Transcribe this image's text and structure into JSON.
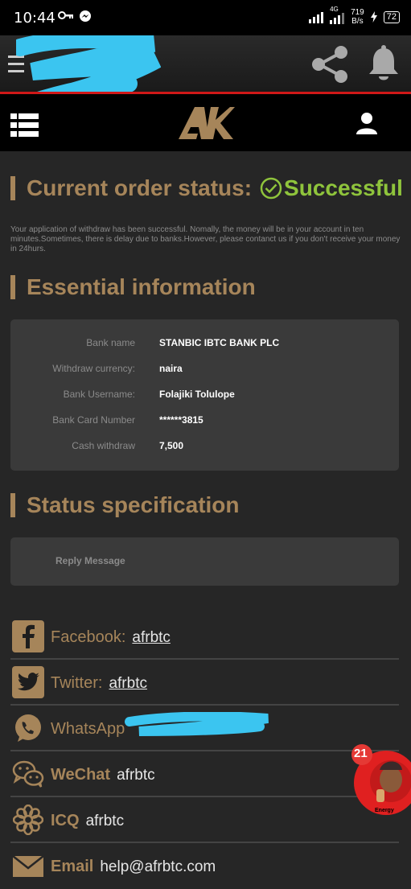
{
  "statusbar": {
    "time": "10:44",
    "network": "4G",
    "speed_value": "719",
    "speed_unit": "B/s",
    "battery": "72"
  },
  "appbar": {
    "menu_icon": "menu-icon",
    "share_icon": "share-icon",
    "bell_icon": "bell-icon"
  },
  "logobar": {
    "logo_text": "AK",
    "list_icon": "list-icon",
    "user_icon": "user-icon"
  },
  "order": {
    "heading": "Current order status:",
    "status": "Successful",
    "note": "Your application of withdraw has been successful. Nomally, the money will be in your account in ten minutes.Sometimes, there is delay due to banks.However, please contanct us if you don't receive your money in 24hurs."
  },
  "essential": {
    "heading": "Essential information",
    "rows": [
      {
        "label": "Bank name",
        "value": "STANBIC IBTC BANK PLC"
      },
      {
        "label": "Withdraw currency:",
        "value": "naira"
      },
      {
        "label": "Bank Username:",
        "value": "Folajiki Tolulope"
      },
      {
        "label": "Bank Card Number",
        "value": "******3815"
      },
      {
        "label": "Cash withdraw",
        "value": "7,500"
      }
    ]
  },
  "status_spec": {
    "heading": "Status specification",
    "reply_label": "Reply Message"
  },
  "social": [
    {
      "name": "Facebook:",
      "handle": "afrbtc",
      "icon": "facebook-icon"
    },
    {
      "name": "Twitter:",
      "handle": "afrbtc",
      "icon": "twitter-icon"
    },
    {
      "name": "WhatsApp",
      "handle": "",
      "icon": "whatsapp-icon"
    },
    {
      "name": "WeChat",
      "handle": "afrbtc",
      "icon": "wechat-icon"
    },
    {
      "name": "ICQ",
      "handle": "afrbtc",
      "icon": "icq-icon"
    },
    {
      "name": "Email",
      "handle": "help@afrbtc.com",
      "icon": "email-icon"
    }
  ],
  "chat_bubble": {
    "count": "21",
    "caption": "Energy"
  },
  "colors": {
    "accent_gold": "#a6855a",
    "success_green": "#8fc43c",
    "red_line": "#d01818",
    "background": "#262626",
    "card": "#3a3a3a"
  }
}
